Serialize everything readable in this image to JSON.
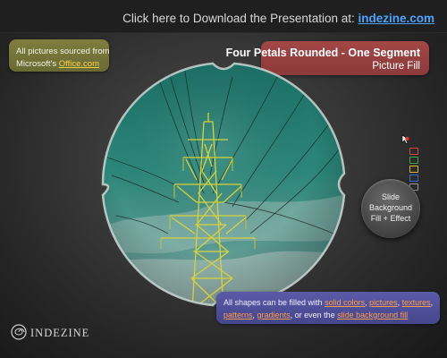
{
  "header": {
    "download_prefix": "Click here to Download the Presentation at: ",
    "download_link": "indezine.com"
  },
  "credit_note": {
    "line1": "All pictures sourced from",
    "line2_prefix": "Microsoft's ",
    "line2_link": "Office.com"
  },
  "title": {
    "main": "Four Petals Rounded - One Segment",
    "sub": "Picture Fill"
  },
  "nav_button": {
    "line1": "Slide",
    "line2": "Background",
    "line3": "Fill + Effect"
  },
  "info": {
    "prefix": "All shapes can be filled with ",
    "link1": "solid colors",
    "sep1": ", ",
    "link2": "pictures",
    "sep2": ", ",
    "link3": "textures",
    "sep3": ",",
    "link4": "patterns",
    "sep4": ", ",
    "link5": "gradients",
    "sep5": ", or even the ",
    "link6": "slide background fill"
  },
  "logo": {
    "text": "INDEZINE",
    "icon": "spiral-logo-icon"
  },
  "colors": {
    "accent_link": "#4aa3ff",
    "note_box": "#7a7a3c",
    "title_box": "#9a4242",
    "info_box": "#50509a",
    "sky_teal": "#1f7a6e",
    "tower_yellow": "#d6d23a"
  }
}
